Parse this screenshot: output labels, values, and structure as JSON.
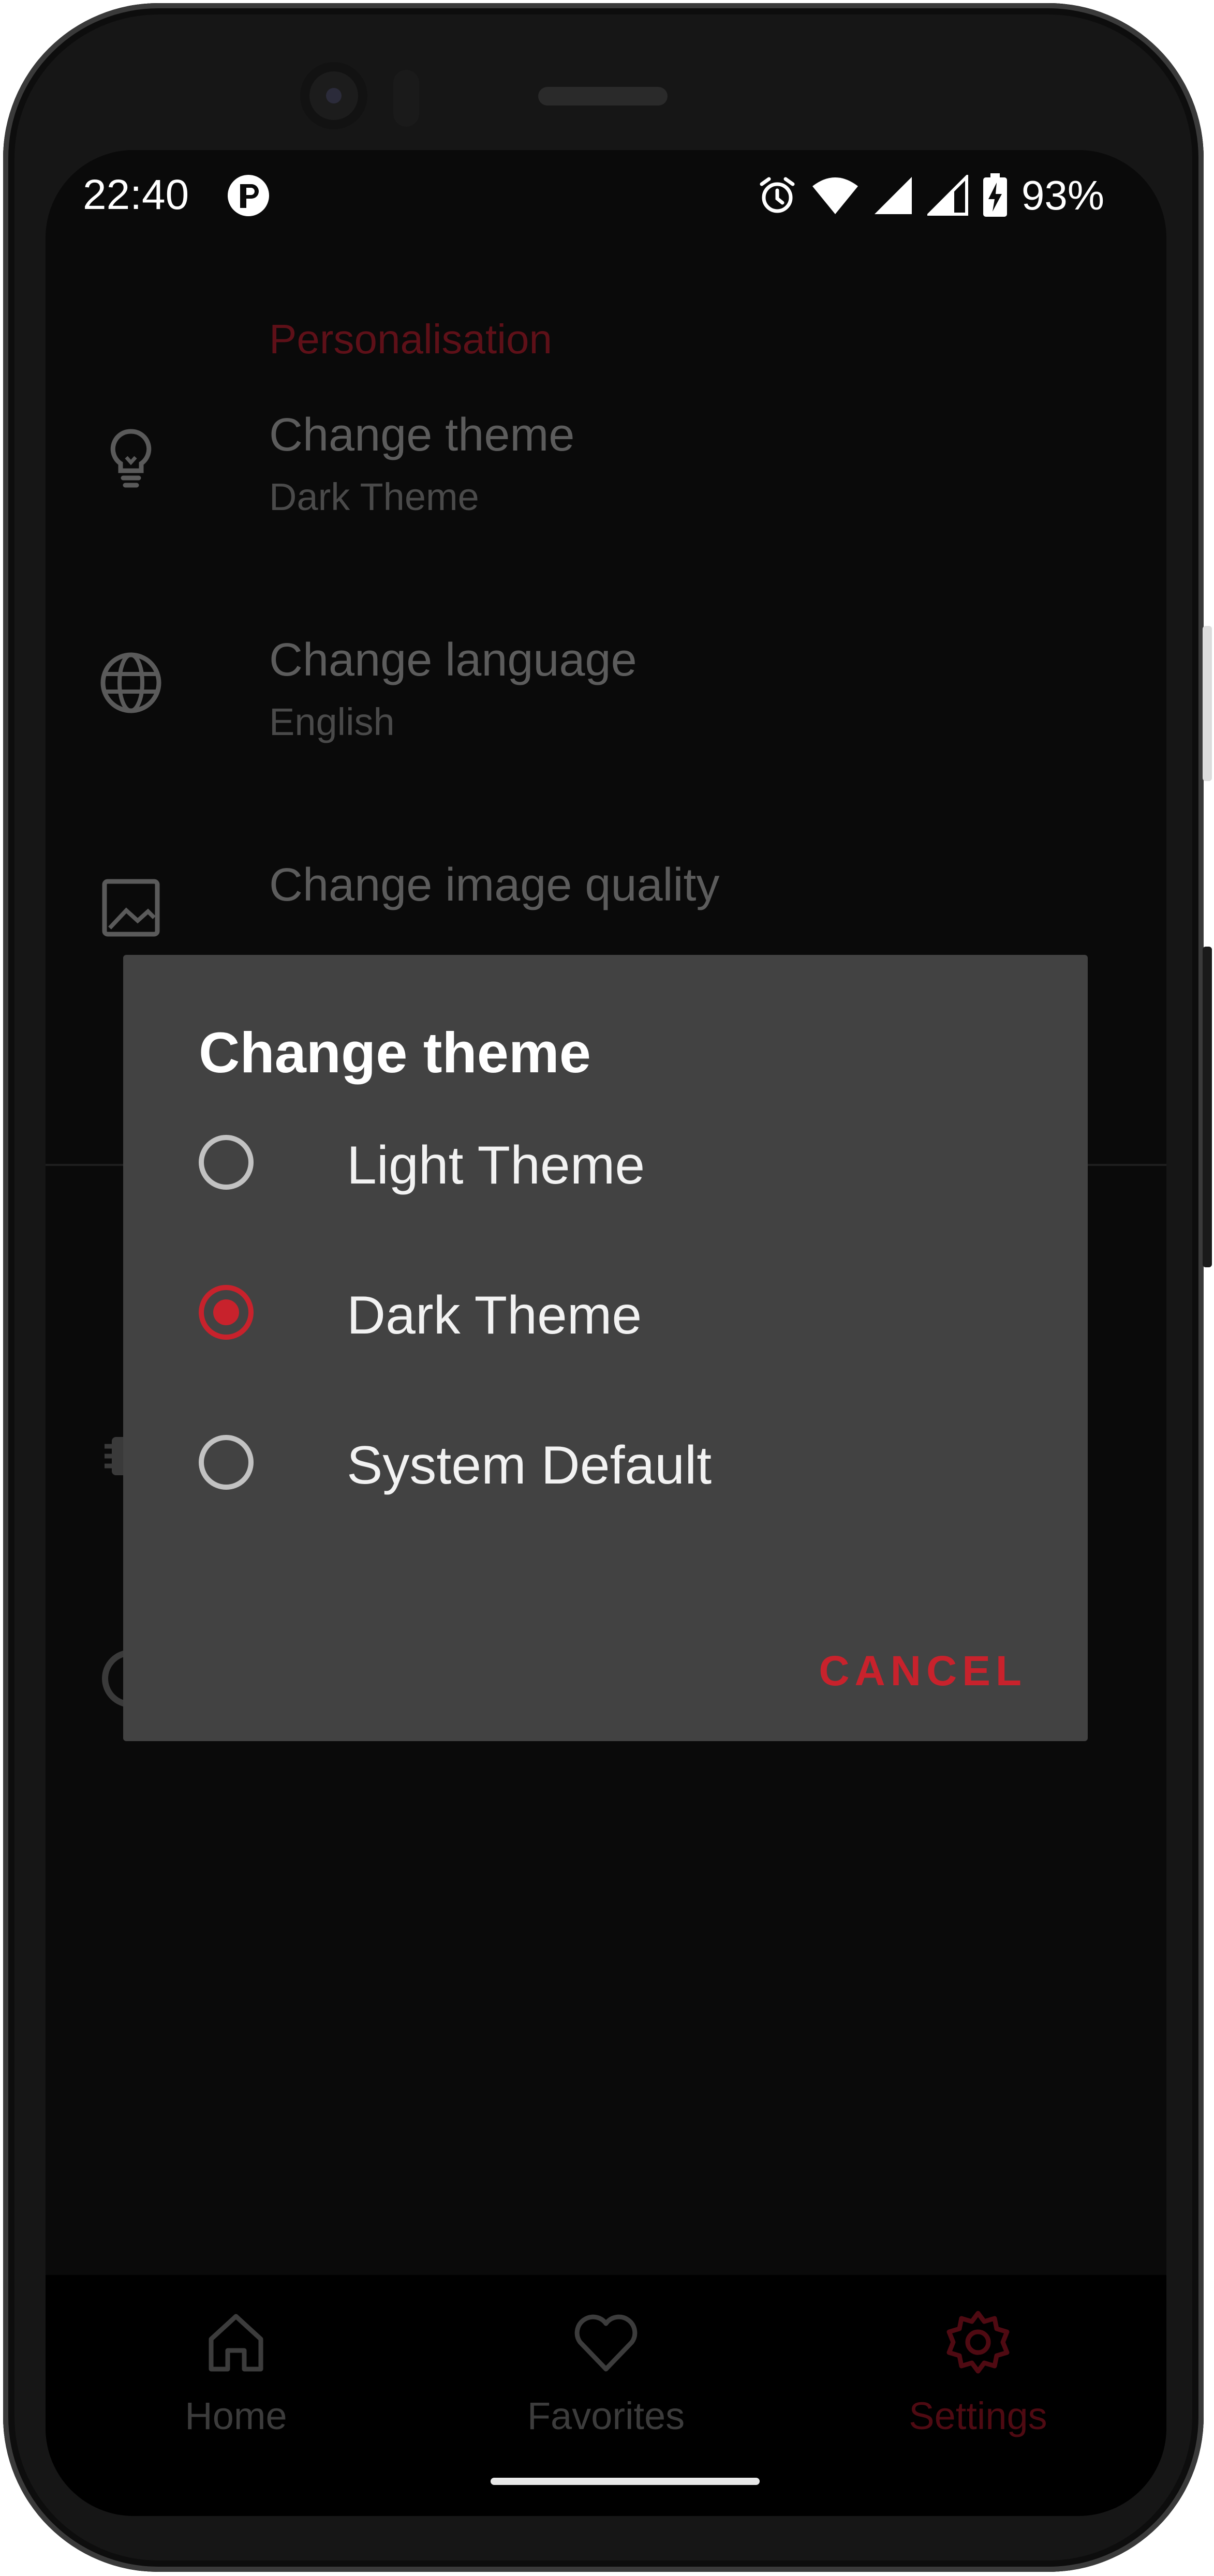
{
  "status_bar": {
    "time": "22:40",
    "battery_percent": "93%",
    "icons": [
      "app-notification-icon",
      "alarm-icon",
      "wifi-icon",
      "signal-icon",
      "signal-icon",
      "battery-charging-icon"
    ]
  },
  "settings": {
    "section_header": "Personalisation",
    "items": [
      {
        "icon": "lightbulb-icon",
        "title": "Change theme",
        "subtitle": "Dark Theme"
      },
      {
        "icon": "globe-icon",
        "title": "Change language",
        "subtitle": "English"
      },
      {
        "icon": "image-icon",
        "title": "Change image quality",
        "subtitle": ""
      }
    ]
  },
  "dialog": {
    "title": "Change theme",
    "options": [
      {
        "label": "Light Theme",
        "selected": false
      },
      {
        "label": "Dark Theme",
        "selected": true
      },
      {
        "label": "System Default",
        "selected": false
      }
    ],
    "cancel_label": "CANCEL"
  },
  "bottom_nav": {
    "items": [
      {
        "label": "Home",
        "icon": "home-icon",
        "active": false
      },
      {
        "label": "Favorites",
        "icon": "heart-icon",
        "active": false
      },
      {
        "label": "Settings",
        "icon": "gear-icon",
        "active": true
      }
    ]
  },
  "colors": {
    "accent": "#c8222c",
    "dialog_bg": "#424242",
    "screen_bg": "#0a0a0a"
  }
}
